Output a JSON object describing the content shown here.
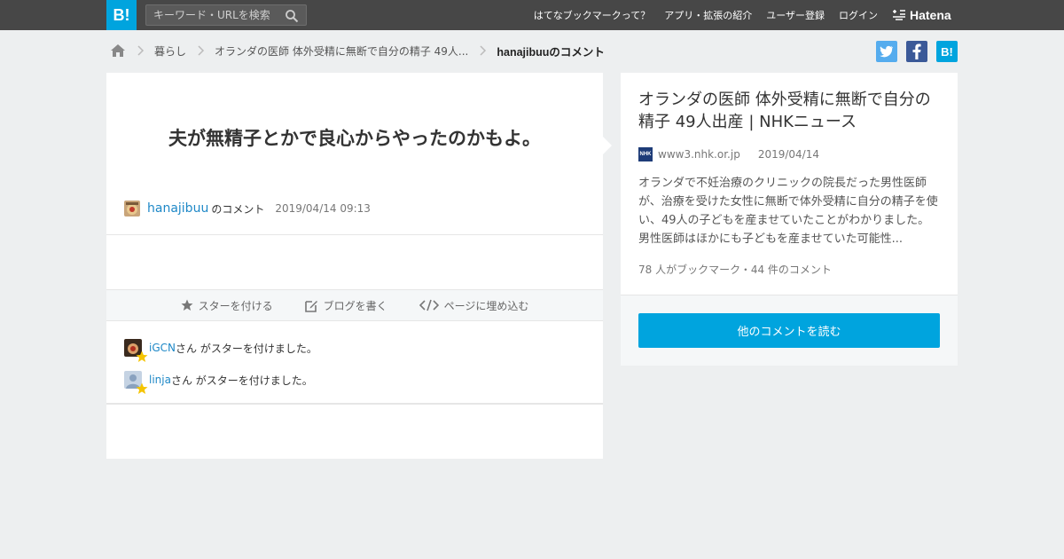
{
  "topbar": {
    "logo": "B!",
    "search_placeholder": "キーワード・URLを検索",
    "nav": [
      "はてなブックマークって？",
      "アプリ・拡張の紹介",
      "ユーザー登録",
      "ログイン"
    ],
    "hatena": "Hatena"
  },
  "breadcrumb": {
    "items": [
      "暮らし",
      "オランダの医師 体外受精に無断で自分の精子 49人..."
    ],
    "current": "hanajibuuのコメント"
  },
  "social": {
    "twitter": "t",
    "facebook": "f",
    "hatebu": "B!"
  },
  "comment": {
    "text": "夫が無精子とかで良心からやったのかもよ。",
    "user": "hanajibuu",
    "suffix": "のコメント",
    "time": "2019/04/14 09:13"
  },
  "actions": {
    "star": "スターを付ける",
    "blog": "ブログを書く",
    "embed": "ページに埋め込む"
  },
  "stars": [
    {
      "name": "iGCN",
      "msg": "さん がスターを付けました。"
    },
    {
      "name": "linja",
      "msg": "さん がスターを付けました。"
    }
  ],
  "entry": {
    "title": "オランダの医師 体外受精に無断で自分の精子 49人出産 | NHKニュース",
    "favicon": "NHK",
    "domain": "www3.nhk.or.jp",
    "date": "2019/04/14",
    "summary": "オランダで不妊治療のクリニックの院長だった男性医師が、治療を受けた女性に無断で体外受精に自分の精子を使い、49人の子どもを産ませていたことがわかりました。男性医師はほかにも子どもを産ませていた可能性...",
    "counts": "78 人がブックマーク・44 件のコメント",
    "cta": "他のコメントを読む"
  },
  "colors": {
    "accent": "#00a4de",
    "link": "#1e88c7",
    "topbar": "#474747",
    "star": "#f5c400"
  }
}
